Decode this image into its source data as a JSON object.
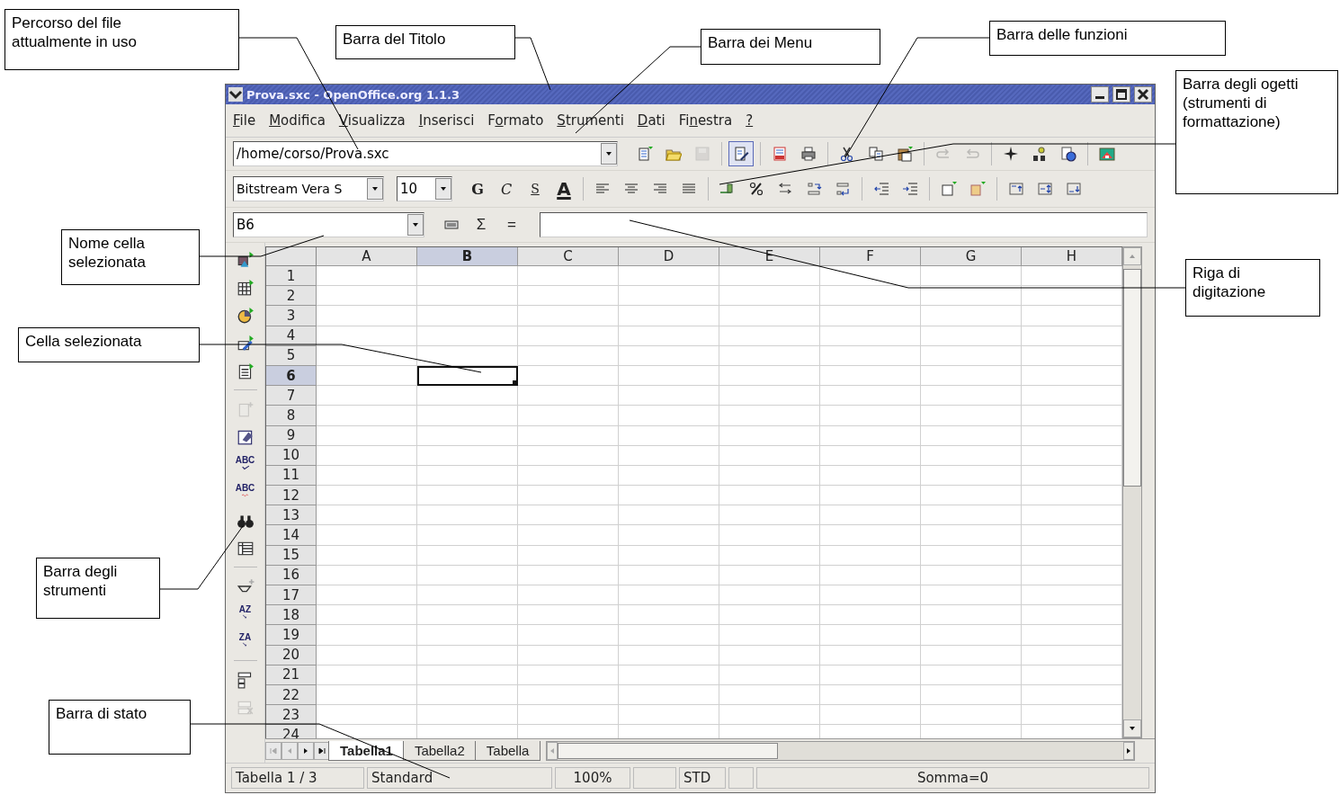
{
  "window": {
    "title": "Prova.sxc - OpenOffice.org 1.1.3"
  },
  "menu": [
    {
      "key": "F",
      "post": "ile"
    },
    {
      "key": "M",
      "post": "odifica"
    },
    {
      "key": "V",
      "post": "isualizza"
    },
    {
      "key": "I",
      "post": "nserisci"
    },
    {
      "pre": "F",
      "key": "o",
      "post": "rmato"
    },
    {
      "key": "S",
      "post": "trumenti"
    },
    {
      "key": "D",
      "post": "ati"
    },
    {
      "pre": "Fi",
      "key": "n",
      "post": "estra"
    },
    {
      "key": "?"
    }
  ],
  "function_bar": {
    "url": "/home/corso/Prova.sxc",
    "buttons": [
      {
        "disabled": false,
        "pressed": false
      },
      {
        "disabled": false,
        "pressed": false
      },
      {
        "disabled": true,
        "pressed": false
      },
      {
        "disabled": false,
        "pressed": true
      },
      {
        "disabled": false,
        "pressed": false
      },
      {
        "disabled": false,
        "pressed": false
      },
      {
        "disabled": false,
        "pressed": false
      },
      {
        "disabled": false,
        "pressed": false
      },
      {
        "disabled": false,
        "pressed": false
      },
      {
        "disabled": true,
        "pressed": false
      },
      {
        "disabled": true,
        "pressed": false
      },
      {
        "disabled": false,
        "pressed": false
      },
      {
        "disabled": false,
        "pressed": false
      },
      {
        "disabled": false,
        "pressed": false
      },
      {
        "disabled": false,
        "pressed": false
      }
    ]
  },
  "object_bar": {
    "font": "Bitstream Vera S",
    "size": "10",
    "format_buttons": [
      {
        "label": "G",
        "kind": "bold"
      },
      {
        "label": "C",
        "kind": "italic"
      },
      {
        "label": "S",
        "kind": "underline"
      },
      {
        "label": "A",
        "kind": "color"
      }
    ]
  },
  "formula_bar": {
    "cell": "B6",
    "sum": "Σ",
    "equals": "="
  },
  "tools": [
    {
      "disabled": false
    },
    {
      "disabled": false
    },
    {
      "disabled": false
    },
    {
      "disabled": false
    },
    {
      "disabled": false
    },
    {
      "disabled": true
    },
    {
      "disabled": false
    },
    {
      "disabled": false,
      "glyph": "ABC"
    },
    {
      "disabled": false,
      "glyph": "ABC"
    },
    {
      "disabled": false
    },
    {
      "disabled": false
    },
    {
      "disabled": false
    },
    {
      "disabled": false,
      "glyph": "AZ"
    },
    {
      "disabled": false,
      "glyph": "ZA"
    },
    {
      "disabled": false
    },
    {
      "disabled": true
    }
  ],
  "grid": {
    "columns": [
      {
        "label": "A",
        "selected": false
      },
      {
        "label": "B",
        "selected": true
      },
      {
        "label": "C",
        "selected": false
      },
      {
        "label": "D",
        "selected": false
      },
      {
        "label": "E",
        "selected": false
      },
      {
        "label": "F",
        "selected": false
      },
      {
        "label": "G",
        "selected": false
      },
      {
        "label": "H",
        "selected": false
      }
    ],
    "rows": [
      {
        "label": "1",
        "selected": false
      },
      {
        "label": "2",
        "selected": false
      },
      {
        "label": "3",
        "selected": false
      },
      {
        "label": "4",
        "selected": false
      },
      {
        "label": "5",
        "selected": false
      },
      {
        "label": "6",
        "selected": true
      },
      {
        "label": "7",
        "selected": false
      },
      {
        "label": "8",
        "selected": false
      },
      {
        "label": "9",
        "selected": false
      },
      {
        "label": "10",
        "selected": false
      },
      {
        "label": "11",
        "selected": false
      },
      {
        "label": "12",
        "selected": false
      },
      {
        "label": "13",
        "selected": false
      },
      {
        "label": "14",
        "selected": false
      },
      {
        "label": "15",
        "selected": false
      },
      {
        "label": "16",
        "selected": false
      },
      {
        "label": "17",
        "selected": false
      },
      {
        "label": "18",
        "selected": false
      },
      {
        "label": "19",
        "selected": false
      },
      {
        "label": "20",
        "selected": false
      },
      {
        "label": "21",
        "selected": false
      },
      {
        "label": "22",
        "selected": false
      },
      {
        "label": "23",
        "selected": false
      },
      {
        "label": "24",
        "selected": false
      }
    ]
  },
  "sheet_tabs": [
    {
      "label": "Tabella1",
      "selected": true
    },
    {
      "label": "Tabella2",
      "selected": false
    },
    {
      "label": "Tabella",
      "selected": false
    }
  ],
  "status_bar": {
    "sheet": "Tabella 1 / 3",
    "page_style": "Standard",
    "zoom": "100%",
    "mode": "STD",
    "sum": "Somma=0"
  },
  "annotations": [
    {
      "text": "Percorso del file attualmente in uso"
    },
    {
      "text": "Barra del Titolo"
    },
    {
      "text": "Barra dei Menu"
    },
    {
      "text": "Barra delle funzioni"
    },
    {
      "text": "Barra degli ogetti (strumenti di formattazione)"
    },
    {
      "text": "Nome cella selezionata"
    },
    {
      "text": "Riga di digitazione"
    },
    {
      "text": "Cella selezionata"
    },
    {
      "text": "Barra degli strumenti"
    },
    {
      "text": "Barra di stato"
    }
  ]
}
